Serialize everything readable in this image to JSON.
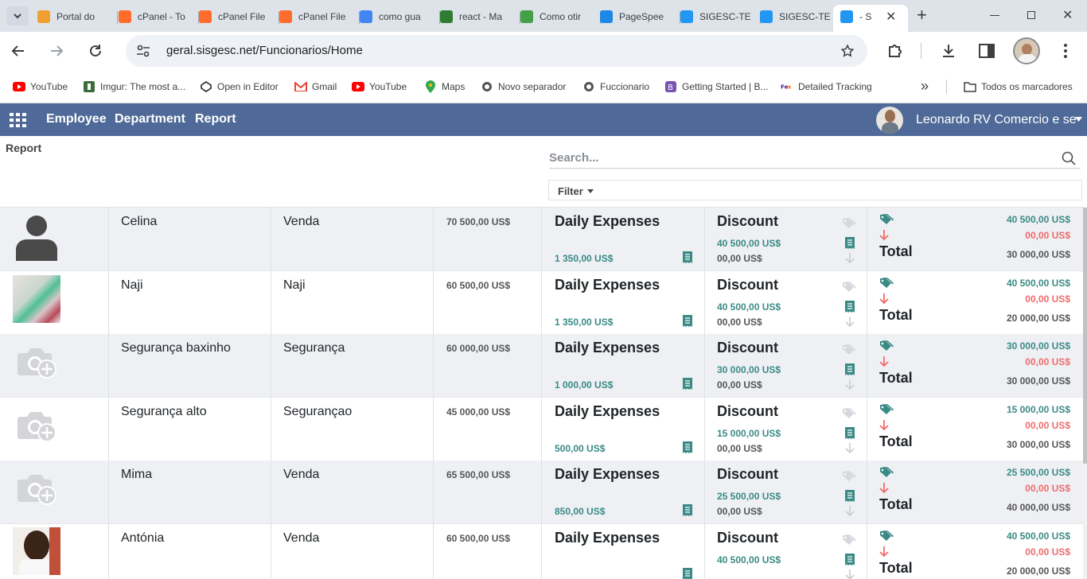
{
  "browser": {
    "tabs": [
      {
        "label": "Portal do",
        "fav_color": "#f0a030"
      },
      {
        "label": "cPanel - To",
        "fav_color": "#ff6c2c"
      },
      {
        "label": "cPanel File",
        "fav_color": "#ff6c2c"
      },
      {
        "label": "cPanel File",
        "fav_color": "#ff6c2c"
      },
      {
        "label": "como gua",
        "fav_color": "#4285f4"
      },
      {
        "label": "react - Ma",
        "fav_color": "#2e7d32"
      },
      {
        "label": "Como otir",
        "fav_color": "#43a047"
      },
      {
        "label": "PageSpee",
        "fav_color": "#1e88e5"
      },
      {
        "label": "SIGESC-TE",
        "fav_color": "#2196f3"
      },
      {
        "label": "SIGESC-TE",
        "fav_color": "#2196f3"
      },
      {
        "label": "- S",
        "fav_color": "#2196f3"
      }
    ],
    "url": "geral.sisgesc.net/Funcionarios/Home",
    "bookmarks": [
      {
        "label": "YouTube",
        "icon": "youtube-icon"
      },
      {
        "label": "Imgur: The most a...",
        "icon": "imgur-icon"
      },
      {
        "label": "Open in Editor",
        "icon": "codepen-icon"
      },
      {
        "label": "Gmail",
        "icon": "gmail-icon"
      },
      {
        "label": "YouTube",
        "icon": "youtube-icon"
      },
      {
        "label": "Maps",
        "icon": "maps-icon"
      },
      {
        "label": "Novo separador",
        "icon": "github-icon"
      },
      {
        "label": "Fuccionario",
        "icon": "github-icon"
      },
      {
        "label": "Getting Started | B...",
        "icon": "bootstrap-icon"
      },
      {
        "label": "Detailed Tracking",
        "icon": "fedex-icon"
      }
    ],
    "all_bookmarks": "Todos os marcadores"
  },
  "app": {
    "nav": [
      "Employee",
      "Department",
      "Report"
    ],
    "user": "Leonardo RV Comercio e se",
    "page_title": "Report",
    "search_placeholder": "Search...",
    "filter_label": "Filter"
  },
  "labels": {
    "daily": "Daily Expenses",
    "discount": "Discount",
    "total": "Total"
  },
  "employees": [
    {
      "name": "Celina",
      "department": "Venda",
      "salary": "70 500,00 US$",
      "daily": "1 350,00 US$",
      "disc_a": "40 500,00 US$",
      "disc_b": "00,00 US$",
      "tot_a": "40 500,00 US$",
      "tot_b": "00,00 US$",
      "tot_c": "30 000,00 US$",
      "avatar": "person"
    },
    {
      "name": "Naji",
      "department": "Naji",
      "salary": "60 500,00 US$",
      "daily": "1 350,00 US$",
      "disc_a": "40 500,00 US$",
      "disc_b": "00,00 US$",
      "tot_a": "40 500,00 US$",
      "tot_b": "00,00 US$",
      "tot_c": "20 000,00 US$",
      "avatar": "photo-clothes"
    },
    {
      "name": "Segurança baxinho",
      "department": "Segurança",
      "salary": "60 000,00 US$",
      "daily": "1 000,00 US$",
      "disc_a": "30 000,00 US$",
      "disc_b": "00,00 US$",
      "tot_a": "30 000,00 US$",
      "tot_b": "00,00 US$",
      "tot_c": "30 000,00 US$",
      "avatar": "camera"
    },
    {
      "name": "Segurança alto",
      "department": "Segurançao",
      "salary": "45 000,00 US$",
      "daily": "500,00 US$",
      "disc_a": "15 000,00 US$",
      "disc_b": "00,00 US$",
      "tot_a": "15 000,00 US$",
      "tot_b": "00,00 US$",
      "tot_c": "30 000,00 US$",
      "avatar": "camera"
    },
    {
      "name": "Mima",
      "department": "Venda",
      "salary": "65 500,00 US$",
      "daily": "850,00 US$",
      "disc_a": "25 500,00 US$",
      "disc_b": "00,00 US$",
      "tot_a": "25 500,00 US$",
      "tot_b": "00,00 US$",
      "tot_c": "40 000,00 US$",
      "avatar": "camera"
    },
    {
      "name": "Antónia",
      "department": "Venda",
      "salary": "60 500,00 US$",
      "daily": "",
      "disc_a": "40 500,00 US$",
      "disc_b": "",
      "tot_a": "40 500,00 US$",
      "tot_b": "00,00 US$",
      "tot_c": "20 000,00 US$",
      "avatar": "photo-person"
    }
  ]
}
